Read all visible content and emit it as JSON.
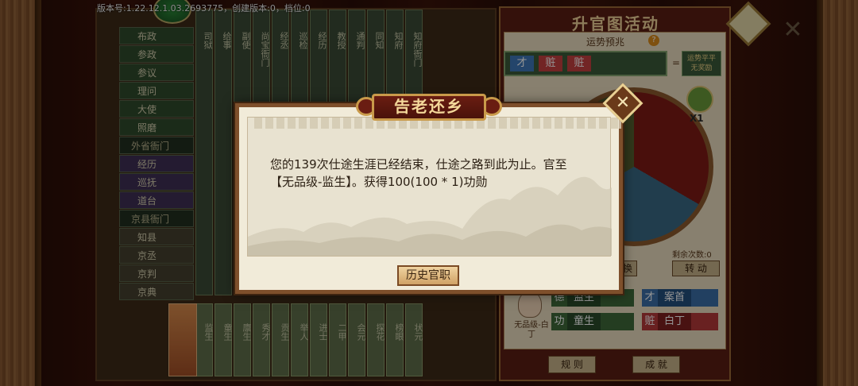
{
  "hud": {
    "version_text": "版本号:1.22.12.1.03.2693775，创建版本:0，档位:0"
  },
  "board": {
    "rank_list": [
      {
        "label": "布政",
        "style": "g"
      },
      {
        "label": "参政",
        "style": "g"
      },
      {
        "label": "参议",
        "style": "g"
      },
      {
        "label": "理问",
        "style": "g"
      },
      {
        "label": "大使",
        "style": "g"
      },
      {
        "label": "照磨",
        "style": "g"
      },
      {
        "label": "外省衙门",
        "style": "hdr"
      },
      {
        "label": "经历",
        "style": "p"
      },
      {
        "label": "巡抚",
        "style": "p"
      },
      {
        "label": "道台",
        "style": "p"
      },
      {
        "label": "京县衙门",
        "style": "hdr"
      },
      {
        "label": "知县",
        "style": "t"
      },
      {
        "label": "京丞",
        "style": "t"
      },
      {
        "label": "京判",
        "style": "t"
      },
      {
        "label": "京典",
        "style": "t"
      }
    ],
    "columns": [
      {
        "label": "司狱"
      },
      {
        "label": "给事"
      },
      {
        "label": "副使"
      },
      {
        "label": "尚宝衙门"
      },
      {
        "label": "经丞"
      },
      {
        "label": "巡检"
      },
      {
        "label": "经历"
      },
      {
        "label": "教授"
      },
      {
        "label": "通判"
      },
      {
        "label": "同知"
      },
      {
        "label": "知府"
      },
      {
        "label": "知府衙门"
      }
    ],
    "bottom_cells": [
      {
        "label": "监生"
      },
      {
        "label": "童生"
      },
      {
        "label": "廪生"
      },
      {
        "label": "秀才"
      },
      {
        "label": "贡生"
      },
      {
        "label": "举人"
      },
      {
        "label": "进士"
      },
      {
        "label": "二甲"
      },
      {
        "label": "会元"
      },
      {
        "label": "探花"
      },
      {
        "label": "榜眼"
      },
      {
        "label": "状元"
      }
    ]
  },
  "panel": {
    "title": "升官图活动",
    "luck_label": "运势预兆",
    "help_icon": "?",
    "slots": [
      "才",
      "赃",
      "赃"
    ],
    "equals": "=",
    "result": "运势平平\n无奖励",
    "multiplier": "X1",
    "remain_label": "剩余次数:0",
    "spin_label": "转 动",
    "swap_label": "换",
    "avatar_label": "无品级-白丁",
    "stats": [
      {
        "tag": "德",
        "value": "监生",
        "color": "green"
      },
      {
        "tag": "才",
        "value": "案首",
        "color": "blue"
      },
      {
        "tag": "功",
        "value": "童生",
        "color": "green"
      },
      {
        "tag": "赃",
        "value": "白丁",
        "color": "red"
      }
    ],
    "rules_label": "规 则",
    "achievement_label": "成 就"
  },
  "modal": {
    "title": "告老还乡",
    "body_line1": "您的139次仕途生涯已经结束，仕途之路到此为止。官至",
    "body_line2": "【无品级-监生】。获得100(100  *  1)功勋",
    "history_button": "历史官职"
  },
  "icons": {
    "close_modal": "close-icon",
    "close_panel": "close-icon",
    "corner": "diamond-icon"
  },
  "colors": {
    "modal_bg": "#f1ebd9",
    "title_plate": "#6a1d12",
    "accent_gold": "#c99a4a"
  }
}
